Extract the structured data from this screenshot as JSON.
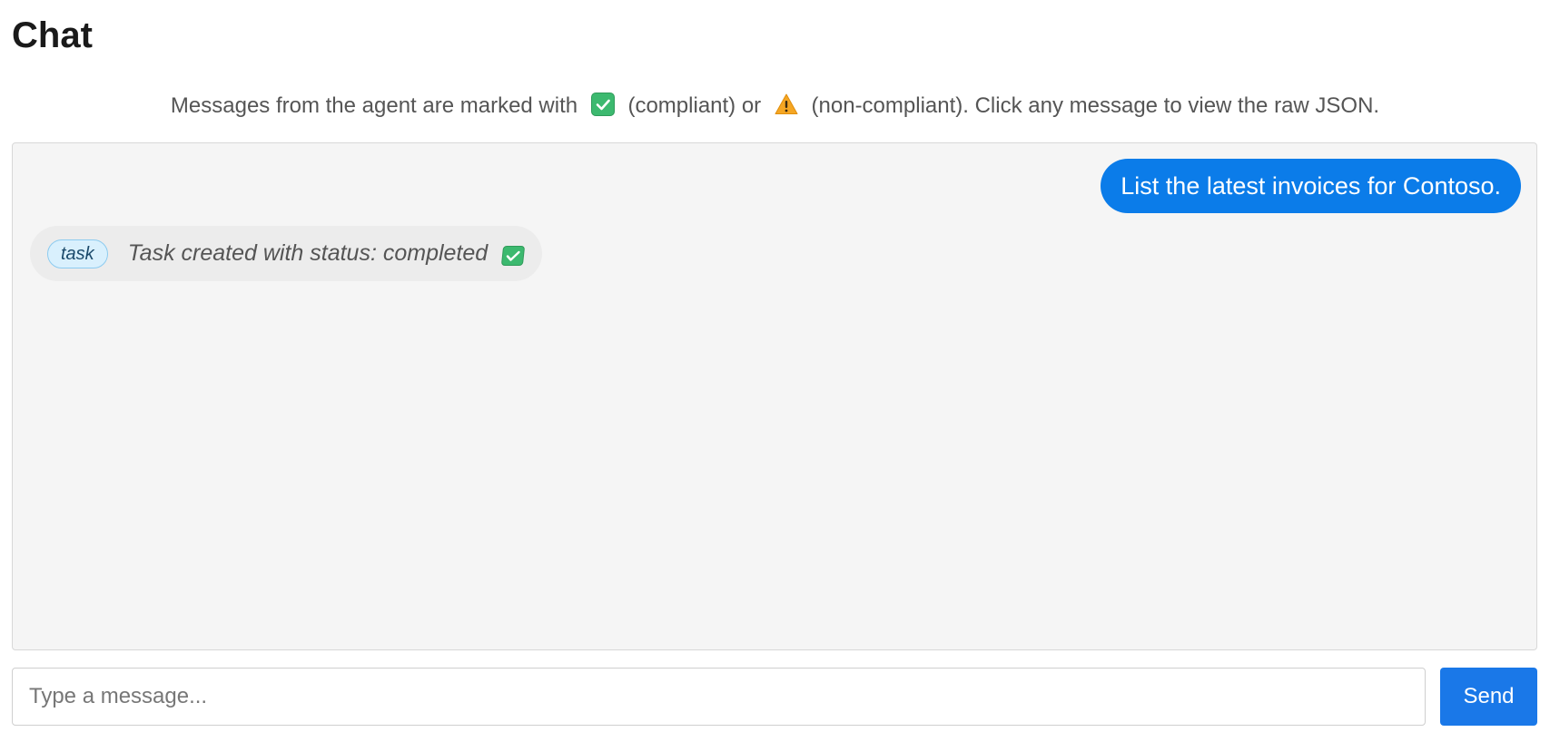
{
  "page": {
    "title": "Chat"
  },
  "legend": {
    "prefix": "Messages from the agent are marked with",
    "compliant_label": "(compliant) or",
    "noncompliant_label": "(non-compliant). Click any message to view the raw JSON.",
    "compliant_icon": "check-icon",
    "noncompliant_icon": "warning-icon"
  },
  "messages": [
    {
      "role": "user",
      "text": "List the latest invoices for Contoso."
    },
    {
      "role": "agent",
      "tag": "task",
      "text": "Task created with status: completed",
      "status_icon": "check-icon",
      "compliant": true
    }
  ],
  "composer": {
    "placeholder": "Type a message...",
    "value": "",
    "send_label": "Send"
  },
  "colors": {
    "user_bubble": "#0b7ce9",
    "send_button": "#1a78e8",
    "compliant": "#3cb96f",
    "warning": "#f5a623"
  }
}
